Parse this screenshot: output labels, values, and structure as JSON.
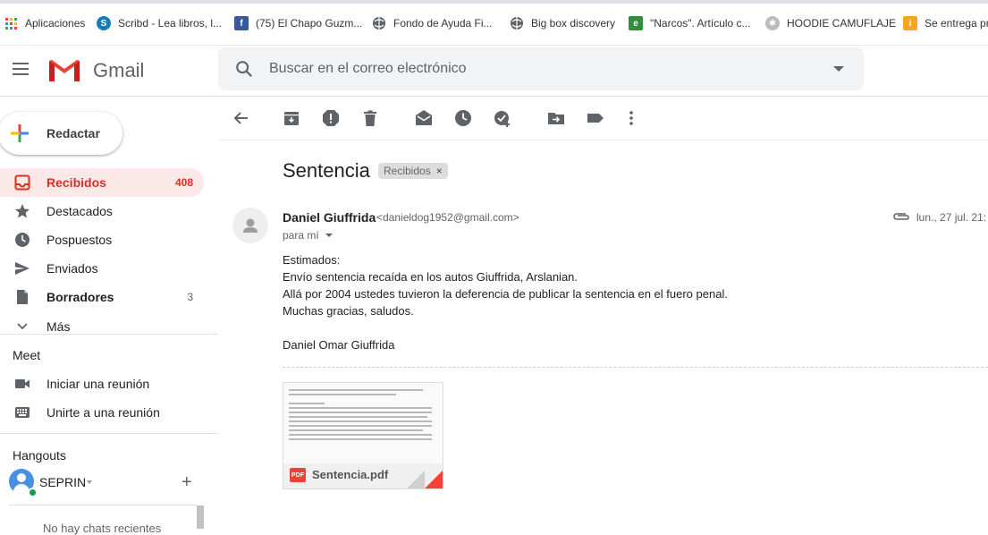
{
  "bookmarks": [
    {
      "label": "Aplicaciones",
      "icon": "apps-grid-icon"
    },
    {
      "label": "Scribd - Lea libros, l...",
      "icon": "scribd-icon"
    },
    {
      "label": "(75) El Chapo Guzm...",
      "icon": "facebook-icon"
    },
    {
      "label": "Fondo de Ayuda Fi...",
      "icon": "globe-icon"
    },
    {
      "label": "Big box discovery",
      "icon": "globe-icon"
    },
    {
      "label": "\"Narcos\". Artículo c...",
      "icon": "elmundo-icon"
    },
    {
      "label": "HOODIE CAMUFLAJE",
      "icon": "brand-icon"
    },
    {
      "label": "Se entrega pr",
      "icon": "bookmark-icon"
    }
  ],
  "header": {
    "app_name": "Gmail",
    "search_placeholder": "Buscar en el correo electrónico"
  },
  "sidebar": {
    "compose_label": "Redactar",
    "items": [
      {
        "label": "Recibidos",
        "count": "408",
        "icon": "inbox-icon"
      },
      {
        "label": "Destacados",
        "count": "",
        "icon": "star-icon"
      },
      {
        "label": "Pospuestos",
        "count": "",
        "icon": "clock-icon"
      },
      {
        "label": "Enviados",
        "count": "",
        "icon": "send-icon"
      },
      {
        "label": "Borradores",
        "count": "3",
        "icon": "draft-icon"
      },
      {
        "label": "Más",
        "count": "",
        "icon": "chevron-down-icon"
      }
    ],
    "meet": {
      "title": "Meet",
      "items": [
        {
          "label": "Iniciar una reunión",
          "icon": "video-icon"
        },
        {
          "label": "Unirte a una reunión",
          "icon": "keyboard-icon"
        }
      ]
    },
    "hangouts": {
      "title": "Hangouts",
      "user": "SEPRIN",
      "no_chats": "No hay chats recientes"
    }
  },
  "message": {
    "subject": "Sentencia",
    "label": "Recibidos",
    "label_close": "×",
    "sender_name": "Daniel Giuffrida",
    "sender_email": "<danieldog1952@gmail.com>",
    "to": "para mí",
    "date": "lun., 27 jul. 21:",
    "body": [
      "Estimados:",
      "Envío sentencia recaída en los autos Giuffrida, Arslanian.",
      "Allá por 2004 ustedes tuvieron la deferencia de publicar la sentencia en el fuero penal.",
      "Muchas gracias, saludos.",
      "",
      "Daniel Omar Giuffrida"
    ],
    "attachment": {
      "filename": "Sentencia.pdf",
      "type": "PDF"
    }
  },
  "colors": {
    "accent_red": "#d93025",
    "active_bg": "#fce8e6",
    "search_bg": "#f1f3f4"
  }
}
